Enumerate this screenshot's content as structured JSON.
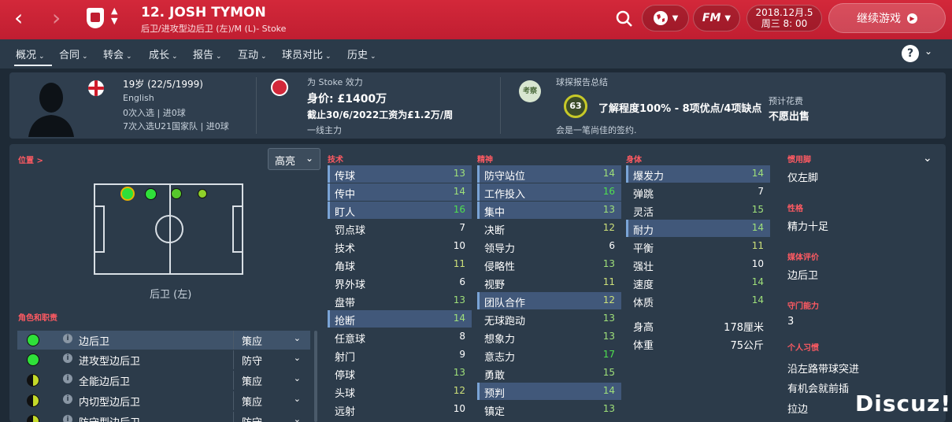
{
  "header": {
    "player_title": "12. JOSH TYMON",
    "player_sub": "后卫/进攻型边后卫 (左)/M (L)- Stoke",
    "date_line1": "2018.12月.5",
    "date_line2": "周三 8: 00",
    "continue_label": "继续游戏",
    "fm_label": "FM"
  },
  "nav": [
    "概况",
    "合同",
    "转会",
    "成长",
    "报告",
    "互动",
    "球员对比",
    "历史"
  ],
  "info": {
    "age": "19岁 (22/5/1999)",
    "nationality": "English",
    "caps1": "0次入选 | 进0球",
    "caps2": "7次入选U21国家队 | 进0球",
    "club_line": "为 Stoke 效力",
    "value": "身价: £1400万",
    "contract": "截止30/6/2022工资为£1.2万/周",
    "squad_status": "一线主力",
    "scout_title": "球探报告总结",
    "scout_badge": "考察",
    "scout_rating": "63",
    "scout_summary": "了解程度100% - 8项优点/4项缺点",
    "scout_note": "会是一笔尚佳的签约.",
    "fee_label": "预计花费",
    "fee_value": "不愿出售"
  },
  "left": {
    "positions_label": "位置 >",
    "highlight_label": "高亮",
    "position_text": "后卫 (左)",
    "roles_label": "角色和职责",
    "roles": [
      {
        "name": "边后卫",
        "duty": "策应",
        "color": "#2fe03a"
      },
      {
        "name": "进攻型边后卫",
        "duty": "防守",
        "color": "#2fe03a"
      },
      {
        "name": "全能边后卫",
        "duty": "策应",
        "color": "#c4d92a"
      },
      {
        "name": "内切型边后卫",
        "duty": "策应",
        "color": "#c4d92a"
      },
      {
        "name": "防守型边后卫",
        "duty": "防守",
        "color": "#c4d92a"
      }
    ]
  },
  "attributes": {
    "technical_label": "技术",
    "mental_label": "精神",
    "physical_label": "身体",
    "technical": [
      {
        "name": "传球",
        "value": "13",
        "color": "#9fe07a",
        "hl": true
      },
      {
        "name": "传中",
        "value": "14",
        "color": "#9fe07a",
        "hl": true
      },
      {
        "name": "盯人",
        "value": "16",
        "color": "#4fe04f",
        "hl": true
      },
      {
        "name": "罚点球",
        "value": "7",
        "color": "#ffffff",
        "hl": false
      },
      {
        "name": "技术",
        "value": "10",
        "color": "#ffffff",
        "hl": false
      },
      {
        "name": "角球",
        "value": "11",
        "color": "#cde07a",
        "hl": false
      },
      {
        "name": "界外球",
        "value": "6",
        "color": "#ffffff",
        "hl": false
      },
      {
        "name": "盘带",
        "value": "13",
        "color": "#9fe07a",
        "hl": false
      },
      {
        "name": "抢断",
        "value": "14",
        "color": "#9fe07a",
        "hl": true
      },
      {
        "name": "任意球",
        "value": "8",
        "color": "#ffffff",
        "hl": false
      },
      {
        "name": "射门",
        "value": "9",
        "color": "#ffffff",
        "hl": false
      },
      {
        "name": "停球",
        "value": "13",
        "color": "#9fe07a",
        "hl": false
      },
      {
        "name": "头球",
        "value": "12",
        "color": "#cde07a",
        "hl": false
      },
      {
        "name": "远射",
        "value": "10",
        "color": "#ffffff",
        "hl": false
      }
    ],
    "mental": [
      {
        "name": "防守站位",
        "value": "14",
        "color": "#9fe07a",
        "hl": true
      },
      {
        "name": "工作投入",
        "value": "16",
        "color": "#4fe04f",
        "hl": true
      },
      {
        "name": "集中",
        "value": "13",
        "color": "#9fe07a",
        "hl": true
      },
      {
        "name": "决断",
        "value": "12",
        "color": "#cde07a",
        "hl": false
      },
      {
        "name": "领导力",
        "value": "6",
        "color": "#ffffff",
        "hl": false
      },
      {
        "name": "侵略性",
        "value": "13",
        "color": "#9fe07a",
        "hl": false
      },
      {
        "name": "视野",
        "value": "11",
        "color": "#cde07a",
        "hl": false
      },
      {
        "name": "团队合作",
        "value": "12",
        "color": "#cde07a",
        "hl": true
      },
      {
        "name": "无球跑动",
        "value": "13",
        "color": "#9fe07a",
        "hl": false
      },
      {
        "name": "想象力",
        "value": "13",
        "color": "#9fe07a",
        "hl": false
      },
      {
        "name": "意志力",
        "value": "17",
        "color": "#4fe04f",
        "hl": false
      },
      {
        "name": "勇敢",
        "value": "15",
        "color": "#9fe07a",
        "hl": false
      },
      {
        "name": "预判",
        "value": "14",
        "color": "#9fe07a",
        "hl": true
      },
      {
        "name": "镇定",
        "value": "13",
        "color": "#9fe07a",
        "hl": false
      }
    ],
    "physical": [
      {
        "name": "爆发力",
        "value": "14",
        "color": "#9fe07a",
        "hl": true
      },
      {
        "name": "弹跳",
        "value": "7",
        "color": "#ffffff",
        "hl": false
      },
      {
        "name": "灵活",
        "value": "15",
        "color": "#9fe07a",
        "hl": false
      },
      {
        "name": "耐力",
        "value": "14",
        "color": "#9fe07a",
        "hl": true
      },
      {
        "name": "平衡",
        "value": "11",
        "color": "#cde07a",
        "hl": false
      },
      {
        "name": "强壮",
        "value": "10",
        "color": "#ffffff",
        "hl": false
      },
      {
        "name": "速度",
        "value": "14",
        "color": "#9fe07a",
        "hl": false
      },
      {
        "name": "体质",
        "value": "14",
        "color": "#9fe07a",
        "hl": false
      }
    ],
    "height_label": "身高",
    "height_value": "178厘米",
    "weight_label": "体重",
    "weight_value": "75公斤"
  },
  "side": {
    "foot_label": "惯用脚",
    "foot_value": "仅左脚",
    "personality_label": "性格",
    "personality_value": "精力十足",
    "media_label": "媒体评价",
    "media_value": "边后卫",
    "gk_label": "守门能力",
    "gk_value": "3",
    "habits_label": "个人习惯",
    "habits": [
      "沿左路带球突进",
      "有机会就前插",
      "拉边"
    ]
  },
  "watermark": "Discuz!"
}
